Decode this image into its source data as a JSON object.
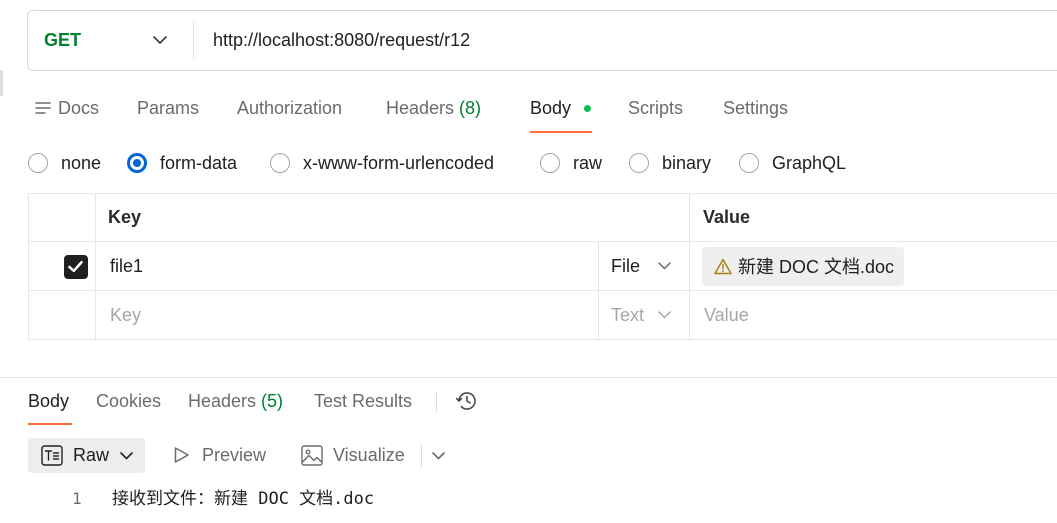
{
  "colors": {
    "method_get": "#007f31",
    "count": "#007f31",
    "active_dot": "#0cbb52",
    "accent": "#ff6c37",
    "radio_selected": "#0265d2",
    "warning": "#a8801a"
  },
  "request": {
    "method": "GET",
    "url": "http://localhost:8080/request/r12"
  },
  "request_tabs": [
    {
      "label": "Docs",
      "icon": "docs-icon",
      "active": false
    },
    {
      "label": "Params",
      "active": false
    },
    {
      "label": "Authorization",
      "active": false
    },
    {
      "label": "Headers",
      "count": "(8)",
      "active": false
    },
    {
      "label": "Body",
      "active": true,
      "has_content": true
    },
    {
      "label": "Scripts",
      "active": false
    },
    {
      "label": "Settings",
      "active": false
    }
  ],
  "body_modes": [
    {
      "label": "none",
      "selected": false
    },
    {
      "label": "form-data",
      "selected": true
    },
    {
      "label": "x-www-form-urlencoded",
      "selected": false
    },
    {
      "label": "raw",
      "selected": false
    },
    {
      "label": "binary",
      "selected": false
    },
    {
      "label": "GraphQL",
      "selected": false
    }
  ],
  "form_table": {
    "headers": {
      "key": "Key",
      "value": "Value"
    },
    "rows": [
      {
        "enabled": true,
        "key": "file1",
        "type": "File",
        "value": "新建 DOC 文档.doc",
        "value_icon": "warning-icon"
      }
    ],
    "new_row": {
      "key_placeholder": "Key",
      "type": "Text",
      "value_placeholder": "Value"
    }
  },
  "response": {
    "tabs": [
      {
        "label": "Body",
        "active": true
      },
      {
        "label": "Cookies",
        "active": false
      },
      {
        "label": "Headers",
        "count": "(5)",
        "active": false
      },
      {
        "label": "Test Results",
        "active": false
      }
    ],
    "history_icon": "history-icon",
    "format": {
      "options": [
        {
          "label": "Raw",
          "icon": "text-format-icon",
          "selected": true
        },
        {
          "label": "Preview",
          "icon": "play-icon",
          "selected": false
        },
        {
          "label": "Visualize",
          "icon": "image-icon",
          "selected": false
        }
      ]
    },
    "lines": [
      {
        "number": "1",
        "text": "接收到文件：新建 DOC 文档.doc"
      }
    ]
  }
}
